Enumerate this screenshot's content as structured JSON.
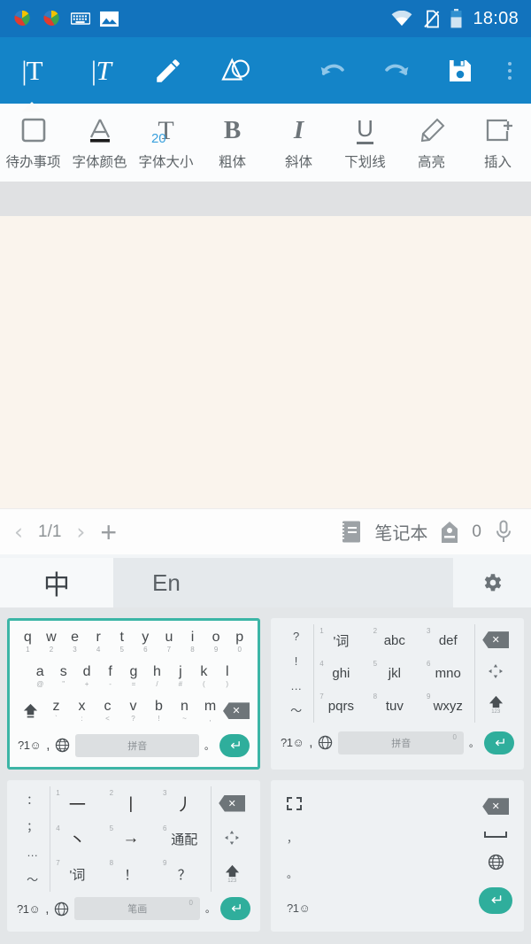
{
  "status_bar": {
    "icons": [
      "app-logo-icon",
      "app-logo-icon",
      "keyboard-icon",
      "image-icon",
      "wifi-icon",
      "no-sim-icon",
      "battery-icon"
    ],
    "time": "18:08"
  },
  "toolbar": {
    "left_tools": [
      {
        "name": "text-tool",
        "glyph": "|T",
        "active": true
      },
      {
        "name": "handwrite-tool",
        "glyph": "|T",
        "active": false
      },
      {
        "name": "pencil-tool",
        "glyph": "pencil-icon",
        "active": false
      },
      {
        "name": "shape-tool",
        "glyph": "shape-icon",
        "active": false
      }
    ],
    "right_tools": [
      {
        "name": "undo-button",
        "glyph": "undo-icon"
      },
      {
        "name": "redo-button",
        "glyph": "redo-icon"
      },
      {
        "name": "save-button",
        "glyph": "save-icon"
      },
      {
        "name": "overflow-menu",
        "glyph": "kebab-icon"
      }
    ]
  },
  "format_bar": {
    "items": [
      {
        "label": "待办事项",
        "icon": "checkbox-icon"
      },
      {
        "label": "字体颜色",
        "icon": "font-color-icon"
      },
      {
        "label": "字体大小",
        "icon": "font-size-icon",
        "value": "20"
      },
      {
        "label": "粗体",
        "icon": "bold-icon",
        "glyph": "B"
      },
      {
        "label": "斜体",
        "icon": "italic-icon",
        "glyph": "I"
      },
      {
        "label": "下划线",
        "icon": "underline-icon",
        "glyph": "U"
      },
      {
        "label": "高亮",
        "icon": "highlighter-icon"
      },
      {
        "label": "插入",
        "icon": "insert-icon"
      }
    ]
  },
  "page_bar": {
    "prev": "‹",
    "page_indicator": "1/1",
    "next": "›",
    "add": "+",
    "notebook_label": "笔记本",
    "tag_count": "0",
    "mic": "mic-icon"
  },
  "keyboard_tabs": {
    "chinese": "中",
    "english": "En",
    "settings": "gear-icon"
  },
  "keyboards": [
    {
      "id": "qwerty-pinyin",
      "selected": true,
      "layout": "qwerty",
      "row1": [
        {
          "key": "q",
          "sub": "1"
        },
        {
          "key": "w",
          "sub": "2"
        },
        {
          "key": "e",
          "sub": "3"
        },
        {
          "key": "r",
          "sub": "4"
        },
        {
          "key": "t",
          "sub": "5"
        },
        {
          "key": "y",
          "sub": "6"
        },
        {
          "key": "u",
          "sub": "7"
        },
        {
          "key": "i",
          "sub": "8"
        },
        {
          "key": "o",
          "sub": "9"
        },
        {
          "key": "p",
          "sub": "0"
        }
      ],
      "row2": [
        {
          "key": "a",
          "sub": "@"
        },
        {
          "key": "s",
          "sub": "\""
        },
        {
          "key": "d",
          "sub": "+"
        },
        {
          "key": "f",
          "sub": "-"
        },
        {
          "key": "g",
          "sub": "="
        },
        {
          "key": "h",
          "sub": "/"
        },
        {
          "key": "j",
          "sub": "#"
        },
        {
          "key": "k",
          "sub": "("
        },
        {
          "key": "l",
          "sub": ")"
        }
      ],
      "row3": [
        {
          "key": "z",
          "sub": "`"
        },
        {
          "key": "x",
          "sub": ":"
        },
        {
          "key": "c",
          "sub": "<"
        },
        {
          "key": "v",
          "sub": "?"
        },
        {
          "key": "b",
          "sub": "!"
        },
        {
          "key": "n",
          "sub": "~"
        },
        {
          "key": "m",
          "sub": ","
        }
      ],
      "shift": "shift-icon",
      "backspace": "backspace-icon",
      "symbols_key": "?1☺",
      "comma_key": ",",
      "globe_key": "globe-icon",
      "space_label": "拼音",
      "space_sub": "",
      "period_key": "。",
      "enter_key": "enter-icon"
    },
    {
      "id": "t9-pinyin",
      "selected": false,
      "layout": "t9",
      "left_column": [
        "?",
        "!",
        "…",
        "～"
      ],
      "cells": [
        {
          "num": "1",
          "label": "'词"
        },
        {
          "num": "2",
          "label": "abc"
        },
        {
          "num": "3",
          "label": "def"
        },
        {
          "num": "4",
          "label": "ghi"
        },
        {
          "num": "5",
          "label": "jkl"
        },
        {
          "num": "6",
          "label": "mno"
        },
        {
          "num": "7",
          "label": "pqrs"
        },
        {
          "num": "8",
          "label": "tuv"
        },
        {
          "num": "9",
          "label": "wxyz"
        }
      ],
      "right_column": [
        "backspace-icon",
        "arrows-icon",
        "shift-icon"
      ],
      "shift_sub": "123",
      "symbols_key": "?1☺",
      "comma_key": ",",
      "globe_key": "globe-icon",
      "space_label": "拼音",
      "space_sub": "0",
      "period_key": "。",
      "enter_key": "enter-icon"
    },
    {
      "id": "stroke",
      "selected": false,
      "layout": "t9",
      "left_column": [
        "：",
        "；",
        "…",
        "～"
      ],
      "cells": [
        {
          "num": "1",
          "label": "一"
        },
        {
          "num": "2",
          "label": "丨"
        },
        {
          "num": "3",
          "label": "丿"
        },
        {
          "num": "4",
          "label": "丶"
        },
        {
          "num": "5",
          "label": "→"
        },
        {
          "num": "6",
          "label": "通配"
        },
        {
          "num": "7",
          "label": "'词"
        },
        {
          "num": "8",
          "label": "！"
        },
        {
          "num": "9",
          "label": "？"
        }
      ],
      "right_column": [
        "backspace-icon",
        "arrows-icon",
        "shift-icon"
      ],
      "shift_sub": "123",
      "symbols_key": "?1☺",
      "comma_key": ",",
      "globe_key": "globe-icon",
      "space_label": "笔画",
      "space_sub": "0",
      "period_key": "。",
      "enter_key": "enter-icon"
    },
    {
      "id": "handwriting",
      "selected": false,
      "layout": "handwriting",
      "left_column": [
        "fullscreen-icon",
        "，",
        "。",
        "?1☺"
      ],
      "right_column": [
        "backspace-icon",
        "space-icon",
        "globe-icon",
        "enter-icon"
      ]
    }
  ],
  "colors": {
    "status_bar": "#1273bd",
    "toolbar": "#1484c8",
    "paper": "#faf4ed",
    "accent_teal": "#3cb5a6",
    "enter_teal": "#2fae9c",
    "font_size_blue": "#39a0dd"
  }
}
